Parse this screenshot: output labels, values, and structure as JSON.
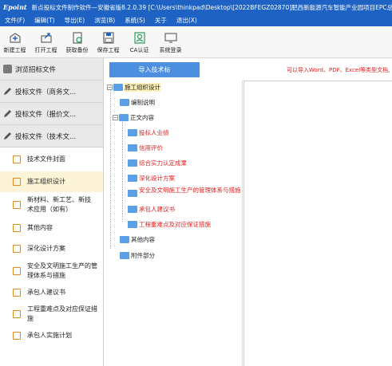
{
  "titlebar": {
    "logo": "Epoint",
    "title": "新点投标文件制作软件—安徽省版8.2.0.39    [C:\\Users\\thinkpad\\Desktop\\[2022BFEGZ02870]肥西新能源汽车智能产业园项目EPC总"
  },
  "menu": [
    "文件(F)",
    "编辑(T)",
    "导出(E)",
    "浏览(B)",
    "系统(S)",
    "关于",
    "退出(X)"
  ],
  "toolbar": [
    {
      "label": "新建工程",
      "icon": "new-project-icon"
    },
    {
      "label": "打开工程",
      "icon": "open-project-icon"
    },
    {
      "label": "获取备份",
      "icon": "get-backup-icon"
    },
    {
      "label": "保存工程",
      "icon": "save-project-icon"
    },
    {
      "label": "CA认证",
      "icon": "ca-cert-icon"
    },
    {
      "label": "系统登录",
      "icon": "system-login-icon"
    }
  ],
  "sidebar": {
    "headers": [
      "浏览招标文件",
      "投标文件（商务文...",
      "投标文件（报价文...",
      "投标文件（技术文..."
    ],
    "items": [
      "技术文件封面",
      "施工组织设计",
      "新材料、新工艺、新技术应用（如有）",
      "其他内容",
      "深化设计方案",
      "安全及文明施工生产的管理体系与措施",
      "承包人建议书",
      "工程重难点及对应保证措施",
      "承包人实施计划"
    ]
  },
  "main": {
    "import_button": "导入技术标",
    "hint": "可以导入Word、PDF、Excel等类型文档,",
    "tree": {
      "root": "施工组织设计",
      "nodes": [
        "编制说明",
        "正文内容",
        "投标人业绩",
        "信用评价",
        "综合实力认定成果",
        "深化设计方案",
        "安全及文明施工生产的管理体系与措施",
        "承包人建议书",
        "工程重难点及对应保证措施",
        "其他内容",
        "附件部分"
      ]
    }
  },
  "colors": {
    "titlebar_bg": "#1e63c4",
    "import_button_bg": "#4c8fe0",
    "hint_red": "#e02020",
    "selected_bg": "#fdf4d8",
    "item_icon_orange": "#e08a1e",
    "folder_blue": "#5aa0e6"
  }
}
